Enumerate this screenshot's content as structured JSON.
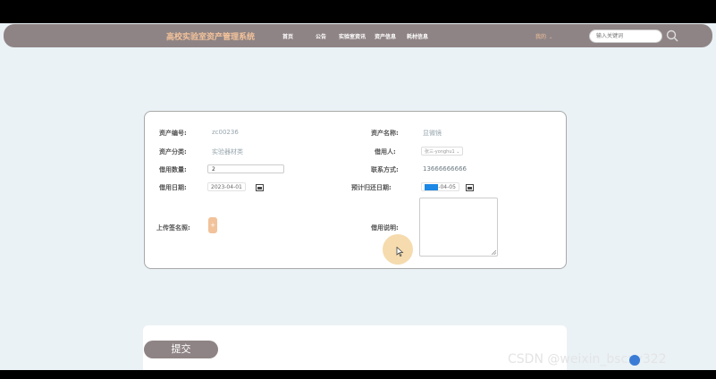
{
  "header": {
    "brand": "高校实验室资产管理系统",
    "nav": [
      "首页",
      "公告",
      "实验室资讯",
      "资产信息",
      "耗材信息"
    ],
    "mine": "我的",
    "search_placeholder": "输入关键词"
  },
  "form": {
    "asset_no_label": "资产编号:",
    "asset_no_value": "zc00236",
    "asset_name_label": "资产名称:",
    "asset_name_value": "显微镜",
    "category_label": "资产分类:",
    "category_value": "实验器材类",
    "borrower_label": "借用人:",
    "borrower_value": "张三-yonghu1",
    "qty_label": "借用数量:",
    "qty_value": "2",
    "contact_label": "联系方式:",
    "contact_value": "13666666666",
    "borrow_date_label": "借用日期:",
    "borrow_date_value": "2023-04-01",
    "return_date_label": "预计归还日期:",
    "return_date_selected": "2023",
    "return_date_rest": "-04-05",
    "signature_label": "上传签名照:",
    "note_label": "借用说明:"
  },
  "submit_label": "提交",
  "watermark": "CSDN @weixin_bscxy322",
  "colors": {
    "topbar": "#8f8485",
    "brand": "#f2c29a",
    "page_bg": "#eaf2f6"
  }
}
